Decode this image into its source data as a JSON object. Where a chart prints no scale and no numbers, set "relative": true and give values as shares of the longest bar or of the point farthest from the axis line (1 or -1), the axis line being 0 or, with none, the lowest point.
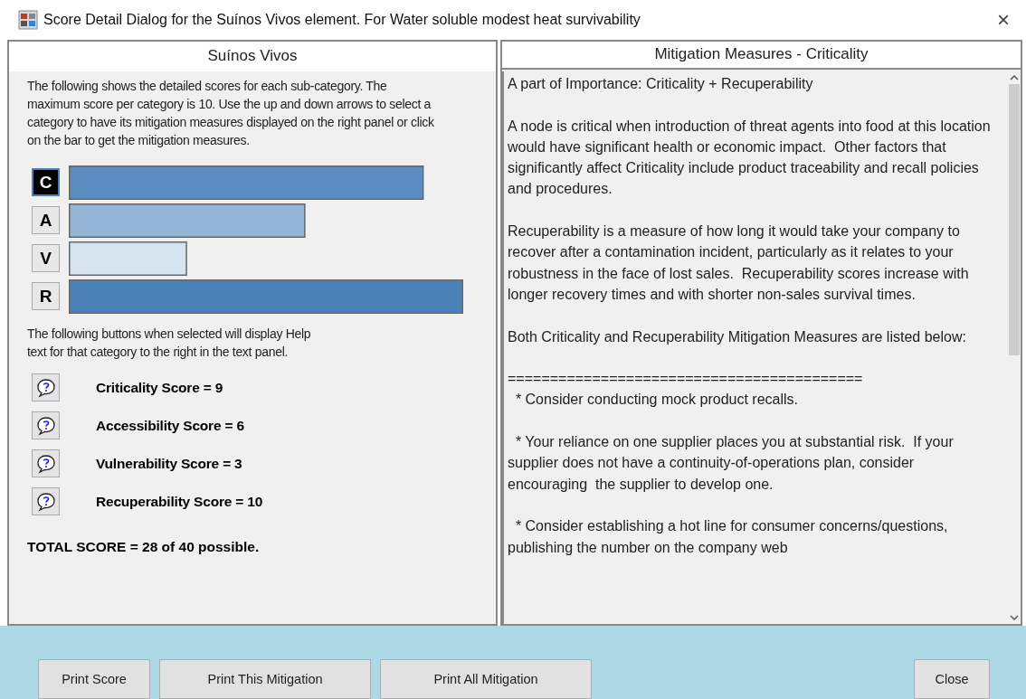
{
  "window": {
    "title": "Score Detail Dialog for the Suínos Vivos element. For Water soluble modest heat survivability",
    "close": "×"
  },
  "left_panel": {
    "title": "Suínos Vivos",
    "intro": "The following shows the detailed scores for each sub-category. The maximum score per category is 10. Use the up and down arrows to select a category to have its mitigation measures displayed on the right panel or click on the bar to get the mitigation measures.",
    "categories": [
      {
        "selected": true,
        "color": "#5a8cbf"
      },
      {
        "selected": false,
        "color": "#94b5d6"
      },
      {
        "selected": false,
        "color": "#d6e4f0"
      },
      {
        "selected": false,
        "color": "#4a82b8"
      }
    ],
    "chart_data": {
      "type": "bar",
      "orientation": "horizontal",
      "categories": [
        "C",
        "A",
        "V",
        "R"
      ],
      "values": [
        0.9,
        0.6,
        0.3,
        1.0
      ],
      "relative": true
    },
    "help_text": "The following buttons when selected will display Help text for that category to the right in the text panel.",
    "scores": [
      {
        "label": "Criticality Score = 9"
      },
      {
        "label": "Accessibility Score = 6"
      },
      {
        "label": "Vulnerability Score = 3"
      },
      {
        "label": "Recuperability Score = 10"
      }
    ],
    "total": "TOTAL SCORE = 28 of 40 possible."
  },
  "right_panel": {
    "title": "Mitigation Measures - Criticality",
    "paragraphs": [
      "A part of Importance: Criticality + Recuperability",
      "A node is critical when introduction of threat agents into food at this location would have significant health or economic impact.  Other factors that significantly affect Criticality include product traceability and recall policies and procedures.",
      "Recuperability is a measure of how long it would take your company to recover after a contamination incident, particularly as it relates to your robustness in the face of lost sales.  Recuperability scores increase with longer recovery times and with shorter non-sales survival times.",
      "Both Criticality and Recuperability Mitigation Measures are listed below:",
      "==========================================\n  * Consider conducting mock product recalls.",
      "  * Your reliance on one supplier places you at substantial risk.  If your supplier does not have a continuity-of-operations plan, consider encouraging  the supplier to develop one.",
      "  * Consider establishing a hot line for consumer concerns/questions, publishing the number on the company web"
    ]
  },
  "buttons": [
    {
      "label": "Print Score"
    },
    {
      "label": "Print This Mitigation"
    },
    {
      "label": "Print All Mitigation"
    },
    {
      "label": "Close"
    }
  ]
}
